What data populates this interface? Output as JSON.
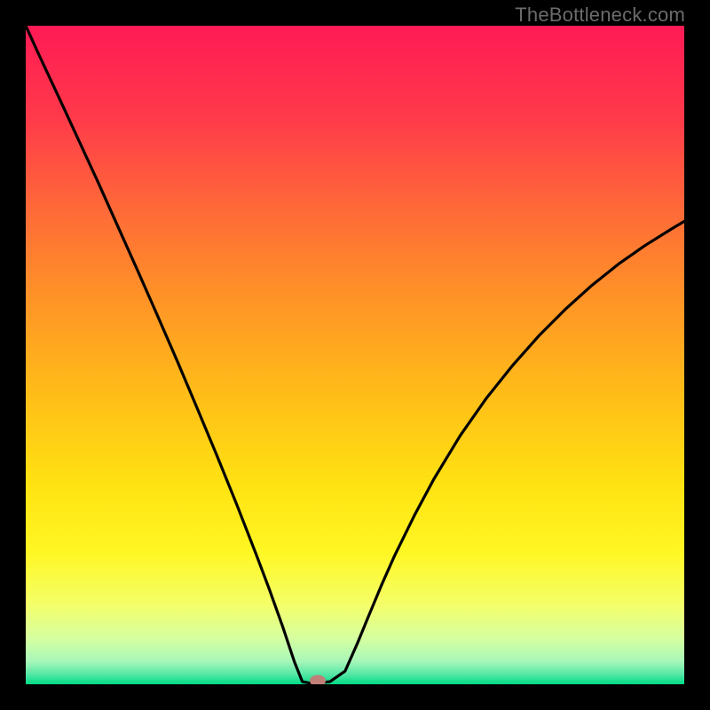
{
  "watermark": "TheBottleneck.com",
  "chart_data": {
    "type": "line",
    "title": "",
    "xlabel": "",
    "ylabel": "",
    "xlim": [
      0,
      100
    ],
    "ylim": [
      0,
      100
    ],
    "grid": false,
    "legend": false,
    "x": [
      0,
      2,
      5,
      8,
      11,
      14,
      17,
      20,
      23,
      26,
      29,
      32,
      35,
      37,
      39,
      40.8,
      42,
      43,
      44.3,
      46.2,
      48.5,
      50.4,
      52,
      54,
      56,
      59,
      62,
      66,
      70,
      74,
      78,
      82,
      86,
      90,
      94,
      98,
      100
    ],
    "y": [
      100,
      95.6,
      89.2,
      82.7,
      76.2,
      69.5,
      62.8,
      56,
      49.1,
      42,
      34.8,
      27.4,
      19.7,
      14.4,
      8.8,
      3.4,
      0.4,
      0.2,
      0.2,
      0.4,
      2,
      6.3,
      10.2,
      15,
      19.5,
      25.6,
      31.2,
      37.8,
      43.5,
      48.5,
      53,
      57,
      60.6,
      63.8,
      66.6,
      69.1,
      70.3
    ],
    "marker": {
      "x": 44.3,
      "y": 0.5
    },
    "gradient_stops": [
      {
        "offset": 0,
        "color": "#ff1a55"
      },
      {
        "offset": 0.14,
        "color": "#ff3a4a"
      },
      {
        "offset": 0.28,
        "color": "#ff6a38"
      },
      {
        "offset": 0.42,
        "color": "#ff9526"
      },
      {
        "offset": 0.56,
        "color": "#ffbd18"
      },
      {
        "offset": 0.7,
        "color": "#ffe312"
      },
      {
        "offset": 0.8,
        "color": "#fff724"
      },
      {
        "offset": 0.88,
        "color": "#f4ff6a"
      },
      {
        "offset": 0.93,
        "color": "#d6ffa0"
      },
      {
        "offset": 0.965,
        "color": "#a8f7b9"
      },
      {
        "offset": 0.985,
        "color": "#55e7a5"
      },
      {
        "offset": 1.0,
        "color": "#00db86"
      }
    ]
  }
}
